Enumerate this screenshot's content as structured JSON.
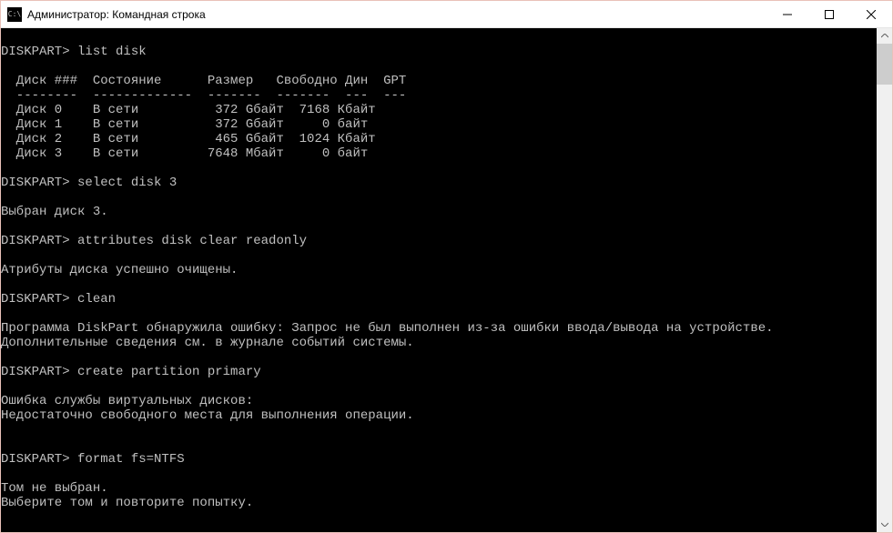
{
  "window": {
    "title": "Администратор: Командная строка"
  },
  "terminal": {
    "lines": [
      "",
      "DISKPART> list disk",
      "",
      "  Диск ###  Состояние      Размер   Свободно Дин  GPT",
      "  --------  -------------  -------  -------  ---  ---",
      "  Диск 0    В сети          372 Gбайт  7168 Кбайт",
      "  Диск 1    В сети          372 Gбайт     0 байт",
      "  Диск 2    В сети          465 Gбайт  1024 Кбайт",
      "  Диск 3    В сети         7648 Mбайт     0 байт",
      "",
      "DISKPART> select disk 3",
      "",
      "Выбран диск 3.",
      "",
      "DISKPART> attributes disk clear readonly",
      "",
      "Атрибуты диска успешно очищены.",
      "",
      "DISKPART> clean",
      "",
      "Программа DiskPart обнаружила ошибку: Запрос не был выполнен из-за ошибки ввода/вывода на устройстве.",
      "Дополнительные сведения см. в журнале событий системы.",
      "",
      "DISKPART> create partition primary",
      "",
      "Ошибка службы виртуальных дисков:",
      "Недостаточно свободного места для выполнения операции.",
      "",
      "",
      "DISKPART> format fs=NTFS",
      "",
      "Том не выбран.",
      "Выберите том и повторите попытку.",
      ""
    ]
  }
}
